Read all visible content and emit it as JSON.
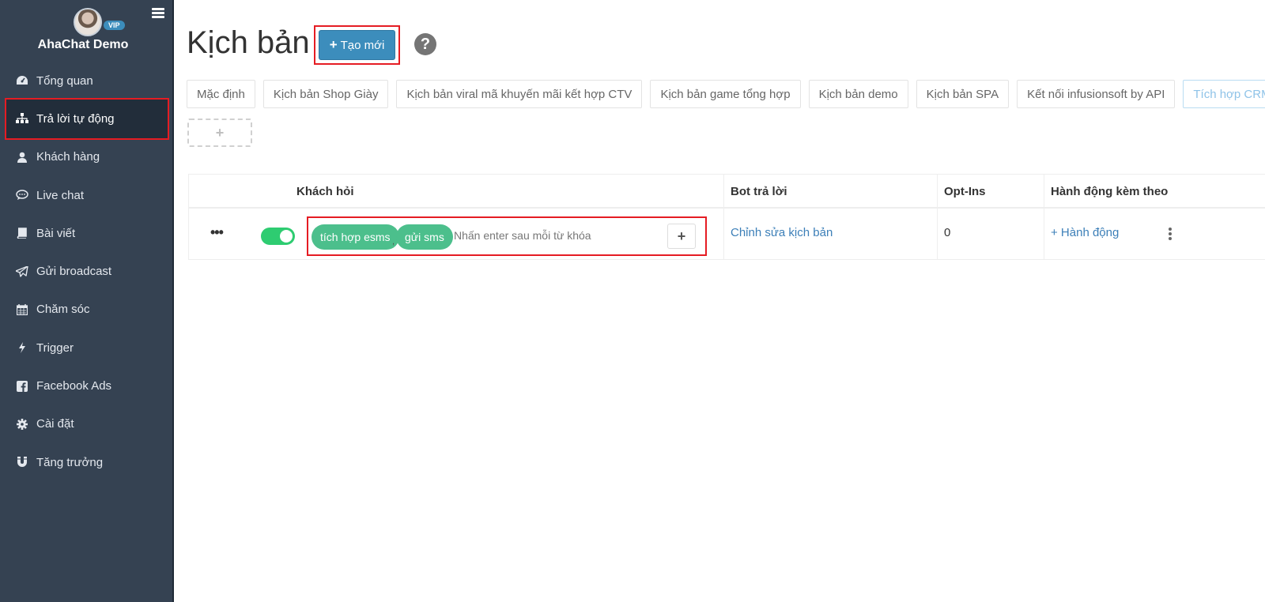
{
  "sidebar": {
    "brand": "AhaChat Demo",
    "vip_badge": "VIP",
    "items": [
      {
        "label": "Tổng quan",
        "icon": "dashboard-icon"
      },
      {
        "label": "Trả lời tự động",
        "icon": "sitemap-icon",
        "active": true
      },
      {
        "label": "Khách hàng",
        "icon": "user-icon"
      },
      {
        "label": "Live chat",
        "icon": "chat-bubble-icon"
      },
      {
        "label": "Bài viết",
        "icon": "book-icon"
      },
      {
        "label": "Gửi broadcast",
        "icon": "paper-plane-icon"
      },
      {
        "label": "Chăm sóc",
        "icon": "calendar-icon"
      },
      {
        "label": "Trigger",
        "icon": "bolt-icon"
      },
      {
        "label": "Facebook Ads",
        "icon": "facebook-icon"
      },
      {
        "label": "Cài đặt",
        "icon": "gear-icon"
      },
      {
        "label": "Tăng trưởng",
        "icon": "magnet-icon"
      }
    ]
  },
  "header": {
    "title": "Kịch bản",
    "create_label": "Tạo mới",
    "help": "?"
  },
  "tabs": [
    "Mặc định",
    "Kịch bản Shop Giày",
    "Kịch bản viral mã khuyến mãi kết hợp CTV",
    "Kịch bản game tổng hợp",
    "Kịch bản demo",
    "Kịch bản SPA",
    "Kết nối infusionsoft by API",
    "Tích hợp CRM"
  ],
  "active_tab": "Tích hợp CRM",
  "add_tab": "+",
  "table": {
    "headers": {
      "question": "Khách hỏi",
      "bot_reply": "Bot trả lời",
      "optins": "Opt-Ins",
      "actions": "Hành động kèm theo"
    },
    "rows": [
      {
        "menu": "•••",
        "enabled": true,
        "keywords": [
          "tích hợp esms",
          "gửi sms"
        ],
        "separator": ",",
        "keyword_placeholder": "Nhấn enter sau mỗi từ khóa",
        "bot_reply_link": "Chỉnh sửa kịch bản",
        "optins": "0",
        "action_link": "+ Hành động"
      }
    ]
  },
  "colors": {
    "sidebar_bg": "#354252",
    "primary": "#3c8dbc",
    "toggle_on": "#2ecc71",
    "chip": "#4cbf8c",
    "highlight": "#e51c23"
  }
}
